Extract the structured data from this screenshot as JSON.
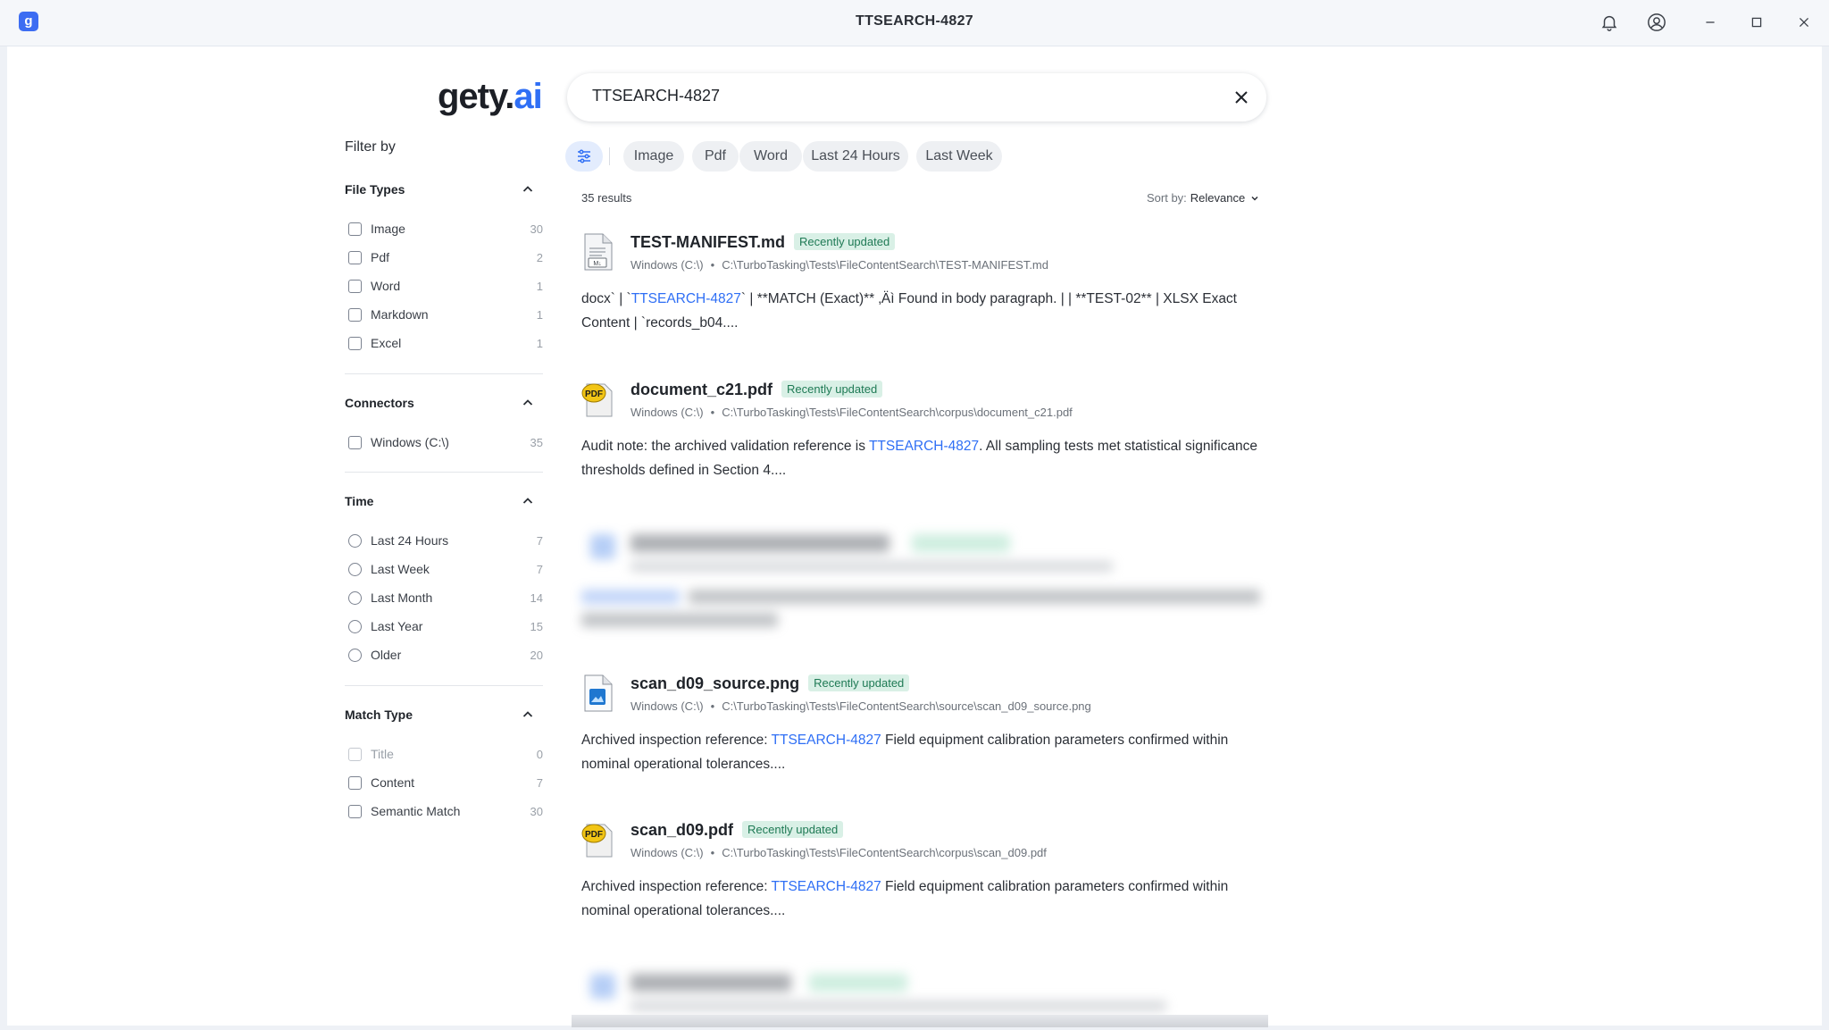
{
  "window": {
    "title": "TTSEARCH-4827",
    "app_icon_letter": "g"
  },
  "logo": {
    "text_main": "gety",
    "text_dot": ".",
    "text_ai": "ai"
  },
  "sidebar": {
    "filter_by": "Filter by",
    "file_types": {
      "title": "File Types",
      "items": [
        {
          "label": "Image",
          "count": "30"
        },
        {
          "label": "Pdf",
          "count": "2"
        },
        {
          "label": "Word",
          "count": "1"
        },
        {
          "label": "Markdown",
          "count": "1"
        },
        {
          "label": "Excel",
          "count": "1"
        }
      ]
    },
    "connectors": {
      "title": "Connectors",
      "items": [
        {
          "label": "Windows (C:\\)",
          "count": "35"
        }
      ]
    },
    "time": {
      "title": "Time",
      "items": [
        {
          "label": "Last 24 Hours",
          "count": "7"
        },
        {
          "label": "Last Week",
          "count": "7"
        },
        {
          "label": "Last Month",
          "count": "14"
        },
        {
          "label": "Last Year",
          "count": "15"
        },
        {
          "label": "Older",
          "count": "20"
        }
      ]
    },
    "match_type": {
      "title": "Match Type",
      "items": [
        {
          "label": "Title",
          "count": "0"
        },
        {
          "label": "Content",
          "count": "7"
        },
        {
          "label": "Semantic Match",
          "count": "30"
        }
      ]
    }
  },
  "search": {
    "value": "TTSEARCH-4827"
  },
  "chips": [
    "Image",
    "Pdf",
    "Word",
    "Last 24 Hours",
    "Last Week"
  ],
  "results_meta": {
    "count": "35 results",
    "sort_label": "Sort by:",
    "sort_value": "Relevance"
  },
  "results": [
    {
      "title": "TEST-MANIFEST.md",
      "badge": "Recently updated",
      "source": "Windows (C:\\)",
      "path": "C:\\TurboTasking\\Tests\\FileContentSearch\\TEST-MANIFEST.md",
      "snippet_pre": "docx` | `",
      "snippet_hl": "TTSEARCH-4827",
      "snippet_post": "` | **MATCH (Exact)** ‚Äì Found in body paragraph. | | **TEST-02** | XLSX Exact Content | `records_b04...."
    },
    {
      "title": "document_c21.pdf",
      "badge": "Recently updated",
      "source": "Windows (C:\\)",
      "path": "C:\\TurboTasking\\Tests\\FileContentSearch\\corpus\\document_c21.pdf",
      "snippet_pre": "Audit note: the archived validation reference is ",
      "snippet_hl": "TTSEARCH-4827",
      "snippet_post": ". All sampling tests met statistical significance thresholds defined in Section 4...."
    },
    {
      "title": "scan_d09_source.png",
      "badge": "Recently updated",
      "source": "Windows (C:\\)",
      "path": "C:\\TurboTasking\\Tests\\FileContentSearch\\source\\scan_d09_source.png",
      "snippet_pre": "Archived inspection reference: ",
      "snippet_hl": "TTSEARCH-4827",
      "snippet_post": " Field equipment calibration parameters confirmed within nominal operational tolerances...."
    },
    {
      "title": "scan_d09.pdf",
      "badge": "Recently updated",
      "source": "Windows (C:\\)",
      "path": "C:\\TurboTasking\\Tests\\FileContentSearch\\corpus\\scan_d09.pdf",
      "snippet_pre": "Archived inspection reference: ",
      "snippet_hl": "TTSEARCH-4827",
      "snippet_post": " Field equipment calibration parameters confirmed within nominal operational tolerances...."
    }
  ],
  "icons": {
    "bell": "bell-icon",
    "account": "account-icon",
    "minimize": "minimize-icon",
    "maximize": "maximize-icon",
    "close": "close-icon",
    "filter": "filter-sliders-icon",
    "clear": "clear-search-icon",
    "chevron_up": "chevron-up-icon",
    "chevron_down": "chevron-down-icon"
  },
  "colors": {
    "accent": "#2f6ff5",
    "badge_bg": "#d9f0e6",
    "badge_text": "#1f7a55"
  }
}
